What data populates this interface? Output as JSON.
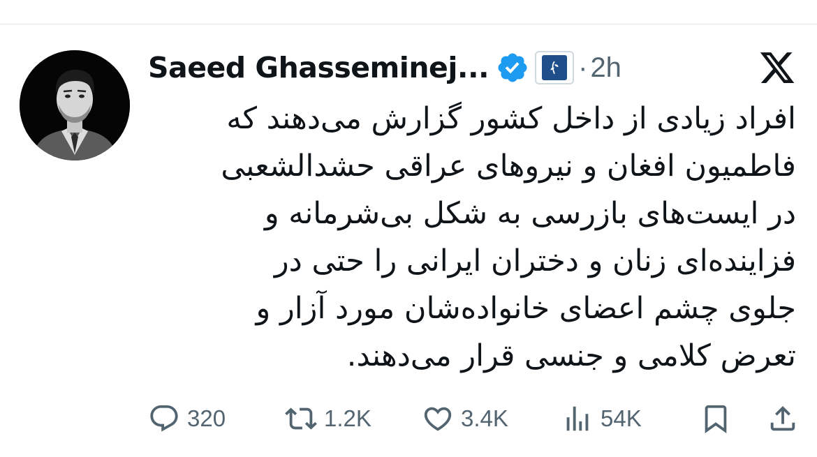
{
  "header": {
    "display_name": "Saeed Ghasseminej...",
    "separator": "·",
    "timestamp": "2h",
    "verified_icon": "blue-verified-badge",
    "affiliate_icon": "affiliate-badge",
    "platform_icon": "x-logo"
  },
  "tweet": {
    "lines": [
      "افراد زیادی از داخل کشور گزارش می‌دهند که",
      "فاطمیون افغان و نیروهای عراقی حشدالشعبی",
      "در ایست‌های بازرسی به شکل بی‌شرمانه و",
      "فزاینده‌ای زنان  و دختران ایرانی را حتی در",
      "جلوی چشم اعضای خانواده‌شان مورد آزار و",
      "تعرض کلامی و جنسی قرار می‌دهند."
    ]
  },
  "actions": {
    "replies": "320",
    "reposts": "1.2K",
    "likes": "3.4K",
    "views": "54K"
  },
  "colors": {
    "text": "#0f1419",
    "muted": "#536471",
    "verified": "#1d9bf0"
  }
}
